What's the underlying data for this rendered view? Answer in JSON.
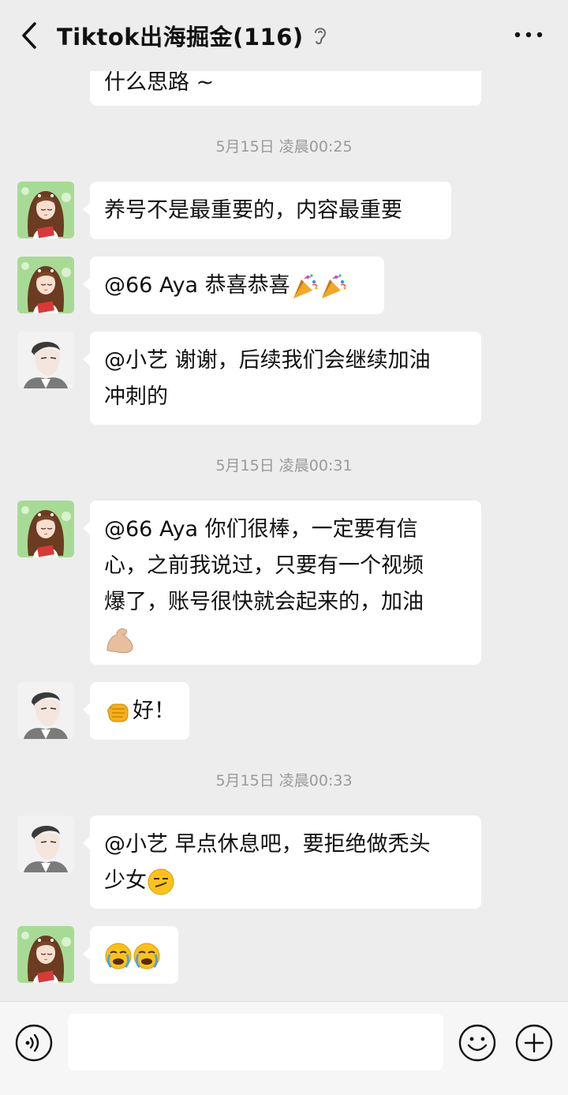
{
  "header": {
    "title": "Tiktok出海掘金(116)"
  },
  "messages": [
    {
      "type": "partial",
      "lines": [
        "什么思路 ~"
      ]
    },
    {
      "type": "time",
      "text": "5月15日 凌晨00:25"
    },
    {
      "type": "msg",
      "sender": "female",
      "lines": [
        "养号不是最重要的，内容最重要"
      ]
    },
    {
      "type": "msg",
      "sender": "female",
      "lines": [
        "@66 Aya 恭喜恭喜"
      ],
      "emojis": [
        "party-popper",
        "party-popper"
      ]
    },
    {
      "type": "msg",
      "sender": "male",
      "lines": [
        "@小艺  谢谢，后续我们会继续加油",
        "冲刺的"
      ]
    },
    {
      "type": "time",
      "text": "5月15日 凌晨00:31"
    },
    {
      "type": "msg",
      "sender": "female",
      "lines": [
        "@66 Aya 你们很棒，一定要有信",
        "心，之前我说过，只要有一个视频",
        "爆了，账号很快就会起来的，加油"
      ],
      "emojis": [
        "flexed-biceps"
      ]
    },
    {
      "type": "msg",
      "sender": "male",
      "lines": [
        "好！"
      ],
      "emojis": [
        "raised-fist"
      ]
    },
    {
      "type": "time",
      "text": "5月15日 凌晨00:33"
    },
    {
      "type": "msg",
      "sender": "male",
      "lines": [
        "@小艺  早点休息吧，要拒绝做秃头",
        "少女"
      ],
      "emojis": [
        "smirk-face"
      ]
    },
    {
      "type": "msg",
      "sender": "female",
      "lines": [],
      "emojis": [
        "crying-face",
        "crying-face"
      ]
    }
  ],
  "input_bar": {
    "icons": [
      "voice-icon",
      "emoji-icon",
      "plus-icon"
    ]
  }
}
